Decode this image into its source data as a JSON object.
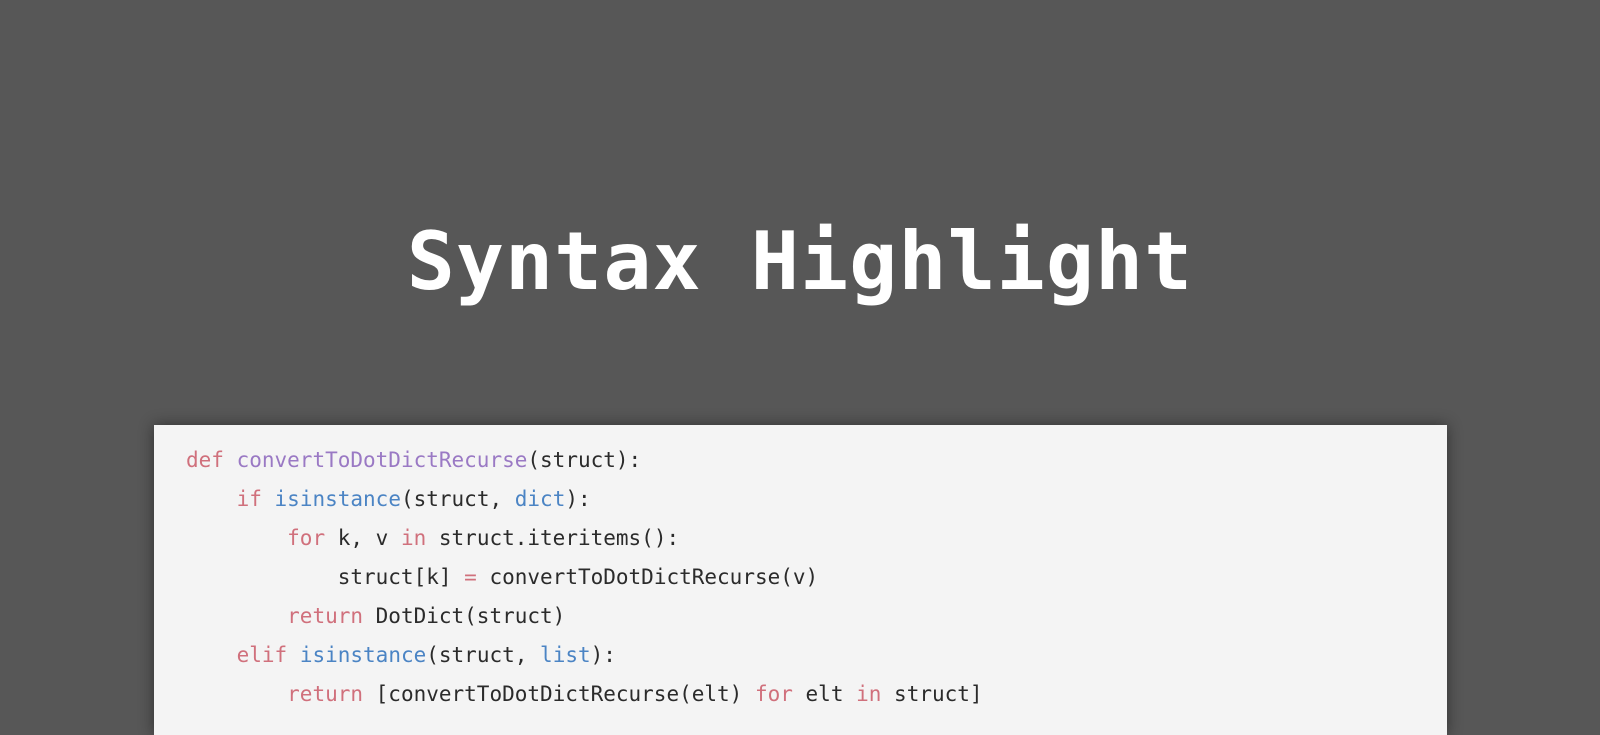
{
  "title": "Syntax Highlight",
  "colors": {
    "background": "#575757",
    "card": "#f4f4f4",
    "keyword": "#d0707c",
    "function_name": "#9a79c4",
    "builtin": "#4b84c4",
    "text": "#2b2b2b"
  },
  "code_lines": [
    [
      {
        "t": "kw",
        "v": "def"
      },
      {
        "t": "tx",
        "v": " "
      },
      {
        "t": "fn",
        "v": "convertToDotDictRecurse"
      },
      {
        "t": "tx",
        "v": "(struct):"
      }
    ],
    [
      {
        "t": "tx",
        "v": "    "
      },
      {
        "t": "kw",
        "v": "if"
      },
      {
        "t": "tx",
        "v": " "
      },
      {
        "t": "bi",
        "v": "isinstance"
      },
      {
        "t": "tx",
        "v": "(struct, "
      },
      {
        "t": "bi",
        "v": "dict"
      },
      {
        "t": "tx",
        "v": "):"
      }
    ],
    [
      {
        "t": "tx",
        "v": "        "
      },
      {
        "t": "kw",
        "v": "for"
      },
      {
        "t": "tx",
        "v": " k, v "
      },
      {
        "t": "kw",
        "v": "in"
      },
      {
        "t": "tx",
        "v": " struct.iteritems():"
      }
    ],
    [
      {
        "t": "tx",
        "v": "            struct[k] "
      },
      {
        "t": "op",
        "v": "="
      },
      {
        "t": "tx",
        "v": " convertToDotDictRecurse(v)"
      }
    ],
    [
      {
        "t": "tx",
        "v": "        "
      },
      {
        "t": "kw",
        "v": "return"
      },
      {
        "t": "tx",
        "v": " DotDict(struct)"
      }
    ],
    [
      {
        "t": "tx",
        "v": "    "
      },
      {
        "t": "kw",
        "v": "elif"
      },
      {
        "t": "tx",
        "v": " "
      },
      {
        "t": "bi",
        "v": "isinstance"
      },
      {
        "t": "tx",
        "v": "(struct, "
      },
      {
        "t": "bi",
        "v": "list"
      },
      {
        "t": "tx",
        "v": "):"
      }
    ],
    [
      {
        "t": "tx",
        "v": "        "
      },
      {
        "t": "kw",
        "v": "return"
      },
      {
        "t": "tx",
        "v": " [convertToDotDictRecurse(elt) "
      },
      {
        "t": "kw",
        "v": "for"
      },
      {
        "t": "tx",
        "v": " elt "
      },
      {
        "t": "kw",
        "v": "in"
      },
      {
        "t": "tx",
        "v": " struct]"
      }
    ]
  ]
}
